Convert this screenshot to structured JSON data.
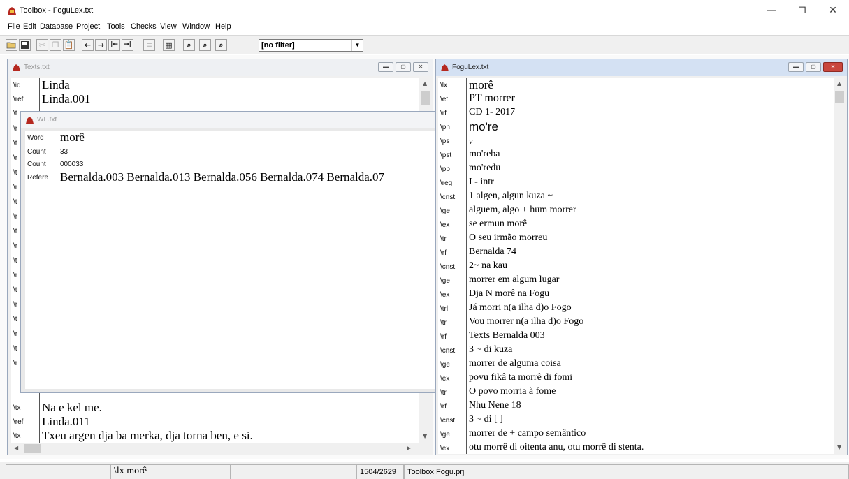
{
  "app": {
    "title": "Toolbox - FoguLex.txt",
    "window_controls": [
      "—",
      "❐",
      "✕"
    ]
  },
  "menu": [
    "File",
    "Edit",
    "Database",
    "Project",
    "Tools",
    "Checks",
    "View",
    "Window",
    "Help"
  ],
  "toolbar": {
    "buttons": [
      "open",
      "save",
      "cut",
      "copy",
      "paste",
      "←",
      "→",
      "|←",
      "→|",
      "list",
      "table",
      "find",
      "find-all",
      "find-next"
    ],
    "filter_value": "[no filter]"
  },
  "texts_window": {
    "title": "Texts.txt",
    "top_rows": [
      {
        "marker": "\\id",
        "value": "Linda"
      },
      {
        "marker": "\\ref",
        "value": "Linda.001"
      },
      {
        "marker": "\\t",
        "value": ""
      }
    ],
    "left_markers": [
      "\\r",
      "\\t",
      "\\r",
      "\\t",
      "\\r",
      "\\t",
      "\\r",
      "\\t",
      "\\r",
      "\\t",
      "\\r",
      "\\t",
      "\\r",
      "\\t",
      "\\r",
      "\\t",
      "\\r"
    ],
    "bottom_rows": [
      {
        "marker": "\\tx",
        "value": "Na e kel me."
      },
      {
        "marker": "\\ref",
        "value": "Linda.011"
      },
      {
        "marker": "\\tx",
        "value": "Txeu argen dja ba merka, dja torna ben, e si."
      }
    ]
  },
  "wl_window": {
    "title": "WL.txt",
    "rows": [
      {
        "marker": "Word",
        "value": "morê"
      },
      {
        "marker": "Count",
        "value": "33"
      },
      {
        "marker": "Count",
        "value": "000033"
      },
      {
        "marker": "Refere",
        "value": "Bernalda.003 Bernalda.013 Bernalda.056 Bernalda.074 Bernalda.07"
      }
    ]
  },
  "lex_window": {
    "title": "FoguLex.txt",
    "rows": [
      {
        "marker": "\\lx",
        "value": "morê"
      },
      {
        "marker": "\\et",
        "value": "PT morrer"
      },
      {
        "marker": "\\rf",
        "value": "CD 1- 2017"
      },
      {
        "marker": "\\ph",
        "value": "mo're"
      },
      {
        "marker": "\\ps",
        "value": "v"
      },
      {
        "marker": "\\pst",
        "value": "mo'reba"
      },
      {
        "marker": "\\pp",
        "value": "mo'redu"
      },
      {
        "marker": "\\reg",
        "value": "I - intr"
      },
      {
        "marker": "\\cnst",
        "value": "1 algen, algun kuza ~"
      },
      {
        "marker": "\\ge",
        "value": "alguem, algo + hum morrer"
      },
      {
        "marker": "\\ex",
        "value": "se ermun morê"
      },
      {
        "marker": "\\tr",
        "value": "O seu irmão morreu"
      },
      {
        "marker": "\\rf",
        "value": "Bernalda 74"
      },
      {
        "marker": "\\cnst",
        "value": "2~ na kau"
      },
      {
        "marker": "\\ge",
        "value": "morrer em algum lugar"
      },
      {
        "marker": "\\ex",
        "value": "Dja N morê na Fogu"
      },
      {
        "marker": "\\trl",
        "value": "Já morri n(a ilha d)o Fogo"
      },
      {
        "marker": "\\tr",
        "value": "Vou morrer n(a ilha d)o Fogo"
      },
      {
        "marker": "\\rf",
        "value": "Texts Bernalda 003"
      },
      {
        "marker": "\\cnst",
        "value": "3 ~ di kuza"
      },
      {
        "marker": "\\ge",
        "value": "morrer de alguma coisa"
      },
      {
        "marker": "\\ex",
        "value": "povu fikâ ta morrê di fomi"
      },
      {
        "marker": "\\tr",
        "value": "O povo morria à fome"
      },
      {
        "marker": "\\rf",
        "value": "Nhu Nene 18"
      },
      {
        "marker": "\\cnst",
        "value": "3  ~ di [ ]"
      },
      {
        "marker": "\\ge",
        "value": "morrer de + campo semântico"
      },
      {
        "marker": "\\ex",
        "value": "otu morrê di oitenta anu, otu morrê di stenta."
      }
    ]
  },
  "statusbar": {
    "record": "\\lx morê",
    "position": "1504/2629",
    "project": "Toolbox Fogu.prj"
  }
}
